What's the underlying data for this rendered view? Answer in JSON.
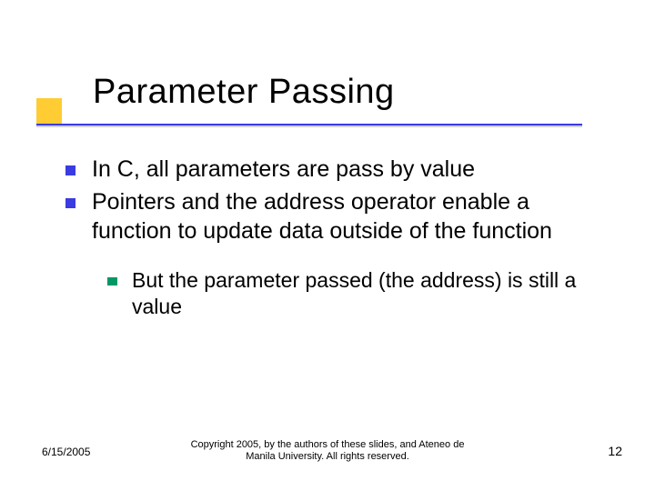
{
  "title": "Parameter Passing",
  "bullets": [
    {
      "text": "In C, all parameters are pass by value"
    },
    {
      "text": "Pointers and the address operator enable a function to update data outside of the function"
    }
  ],
  "subbullets": [
    {
      "text": "But the parameter passed (the address) is still a value"
    }
  ],
  "footer": {
    "date": "6/15/2005",
    "copyright_line1": "Copyright 2005, by the authors of these slides, and Ateneo de",
    "copyright_line2": "Manila University. All rights reserved.",
    "page": "12"
  }
}
